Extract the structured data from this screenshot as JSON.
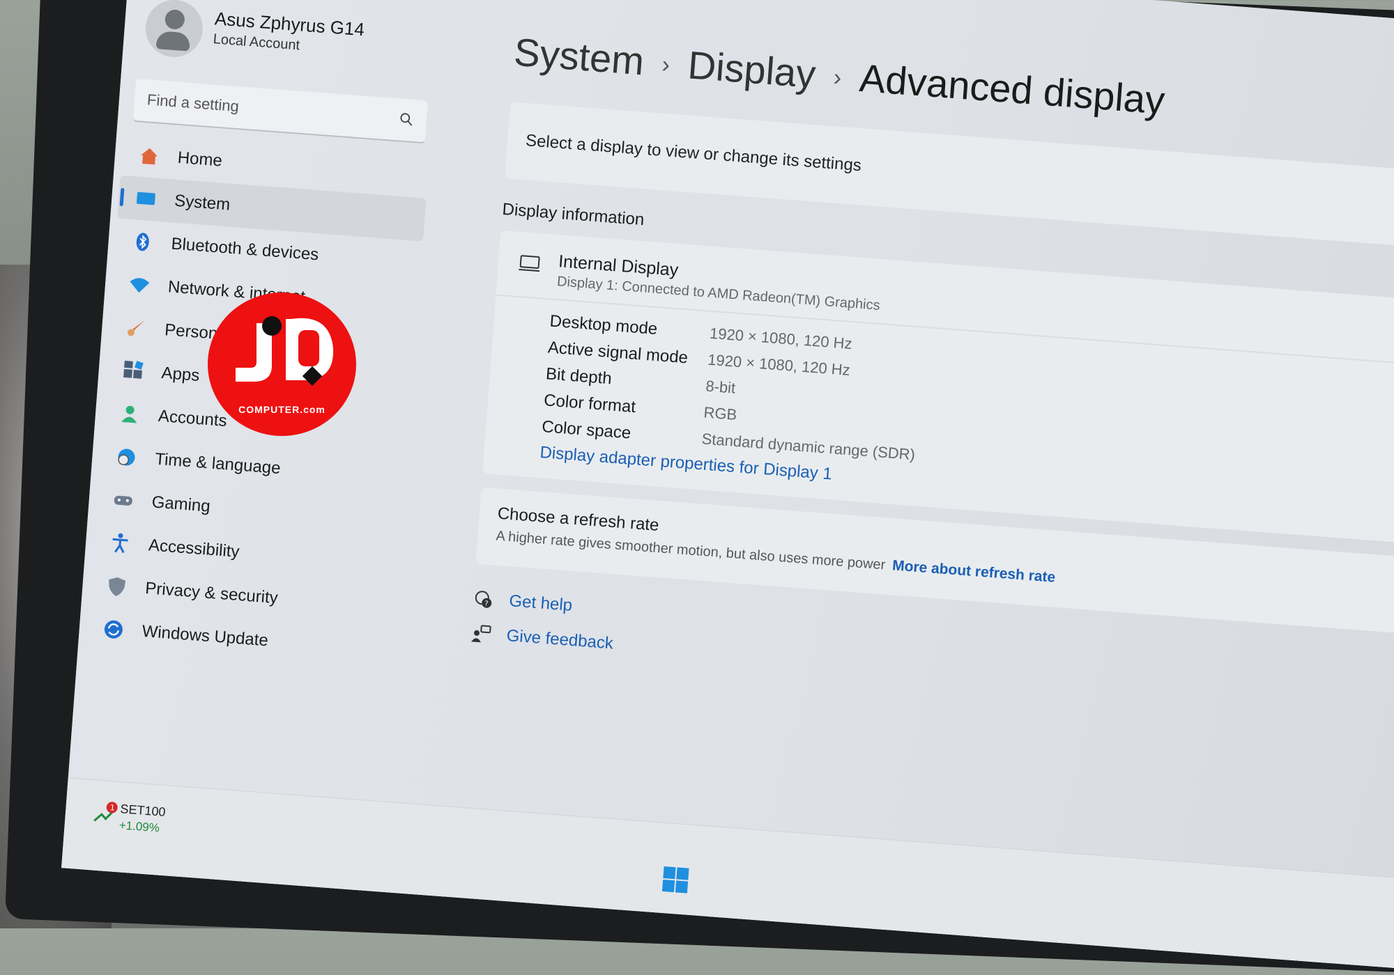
{
  "user": {
    "name": "Asus Zphyrus G14",
    "account_type": "Local Account"
  },
  "search": {
    "placeholder": "Find a setting"
  },
  "nav": [
    {
      "label": "Home",
      "icon": "home-icon",
      "color": "#e0673b"
    },
    {
      "label": "System",
      "icon": "system-icon",
      "color": "#1f8fe0",
      "active": true
    },
    {
      "label": "Bluetooth & devices",
      "icon": "bluetooth-icon",
      "color": "#1f6fd1"
    },
    {
      "label": "Network & internet",
      "icon": "wifi-icon",
      "color": "#1f8fe0"
    },
    {
      "label": "Personalization",
      "icon": "brush-icon",
      "color": "#d9773a"
    },
    {
      "label": "Apps",
      "icon": "apps-icon",
      "color": "#4a5d78"
    },
    {
      "label": "Accounts",
      "icon": "accounts-icon",
      "color": "#2fb07a"
    },
    {
      "label": "Time & language",
      "icon": "globe-clock-icon",
      "color": "#1f8fe0"
    },
    {
      "label": "Gaming",
      "icon": "gamepad-icon",
      "color": "#6b7a8c"
    },
    {
      "label": "Accessibility",
      "icon": "accessibility-icon",
      "color": "#1f6fd1"
    },
    {
      "label": "Privacy & security",
      "icon": "shield-icon",
      "color": "#7a8694"
    },
    {
      "label": "Windows Update",
      "icon": "update-icon",
      "color": "#1f6fd1"
    }
  ],
  "breadcrumb": {
    "root": "System",
    "middle": "Display",
    "current": "Advanced display",
    "separator": "›"
  },
  "select_prompt": "Select a display to view or change its settings",
  "display_info": {
    "section_title": "Display information",
    "name": "Internal Display",
    "subtitle": "Display 1: Connected to AMD Radeon(TM) Graphics",
    "rows": [
      {
        "key": "Desktop mode",
        "value": "1920 × 1080, 120 Hz"
      },
      {
        "key": "Active signal mode",
        "value": "1920 × 1080, 120 Hz"
      },
      {
        "key": "Bit depth",
        "value": "8-bit"
      },
      {
        "key": "Color format",
        "value": "RGB"
      },
      {
        "key": "Color space",
        "value": "Standard dynamic range (SDR)"
      }
    ],
    "adapter_link": "Display adapter properties for Display 1"
  },
  "refresh": {
    "title": "Choose a refresh rate",
    "description": "A higher rate gives smoother motion, but also uses more power",
    "link": "More about refresh rate"
  },
  "help": {
    "get_help": "Get help",
    "give_feedback": "Give feedback"
  },
  "taskbar": {
    "ticker_name": "SET100",
    "ticker_change": "+1.09%",
    "badge_count": "1"
  },
  "watermark": {
    "text": "COMPUTER.com",
    "color": "#ee1111"
  },
  "colors": {
    "accent": "#1f6fd1",
    "link": "#1a5fb4"
  }
}
